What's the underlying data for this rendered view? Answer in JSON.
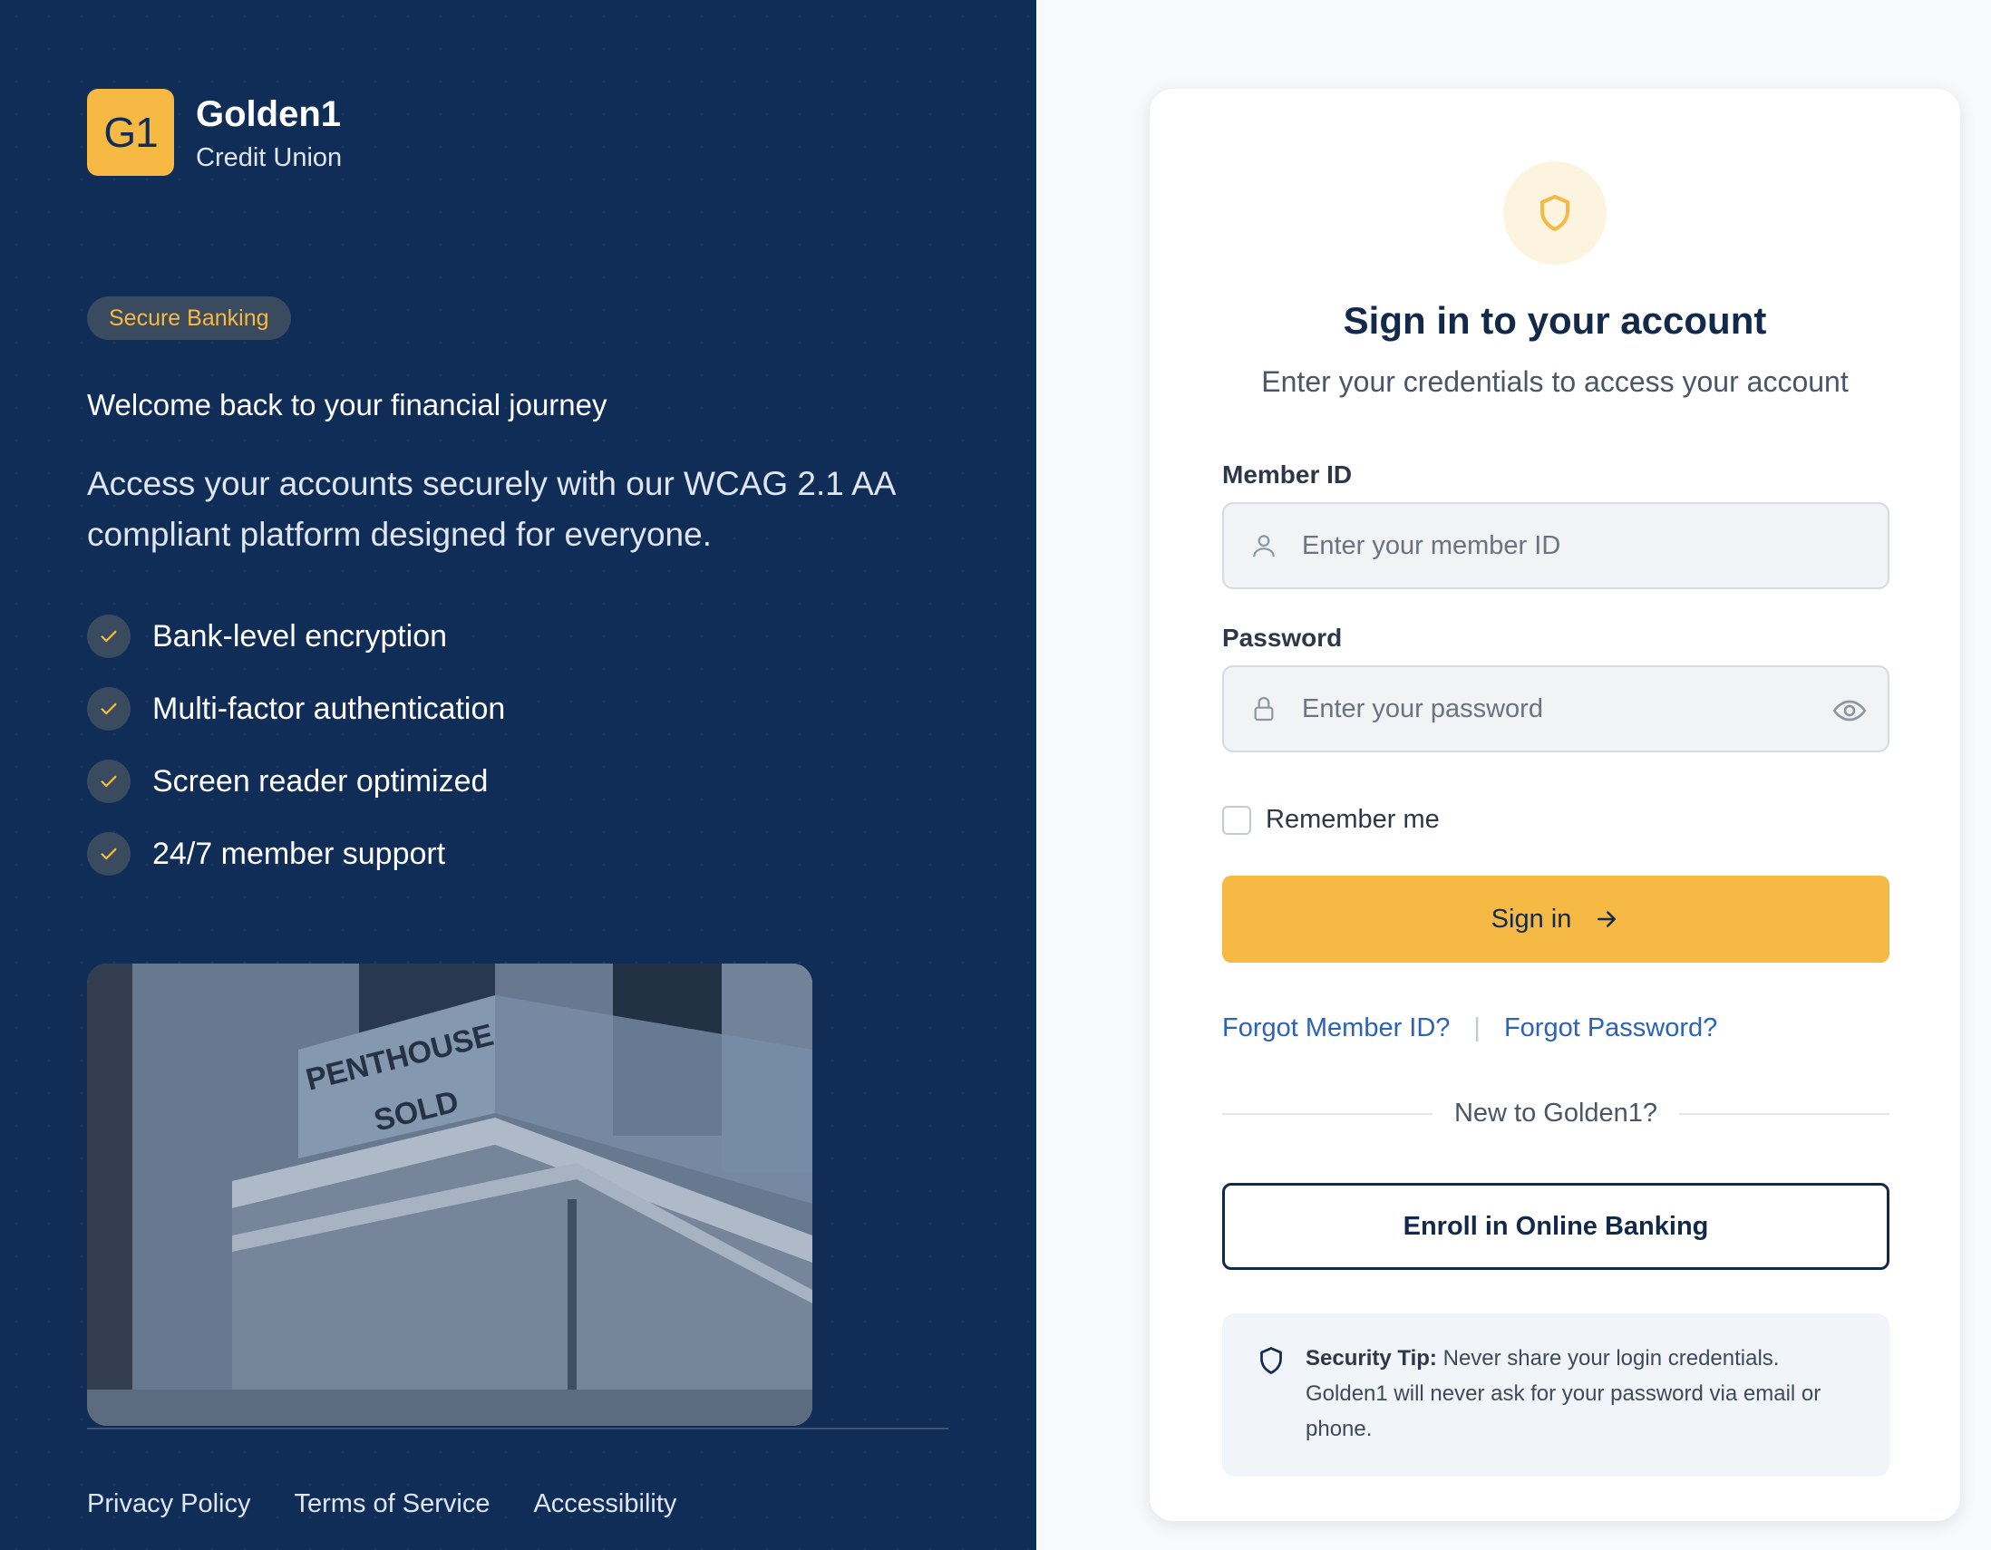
{
  "brand": {
    "logo_text": "G1",
    "name": "Golden1",
    "subtitle": "Credit Union"
  },
  "hero": {
    "badge": "Secure Banking",
    "welcome": "Welcome back to your financial journey",
    "description": "Access your accounts securely with our WCAG 2.1 AA compliant platform designed for everyone.",
    "features": [
      {
        "label": "Bank-level encryption"
      },
      {
        "label": "Multi-factor authentication"
      },
      {
        "label": "Screen reader optimized"
      },
      {
        "label": "24/7 member support"
      }
    ],
    "photo_sign": [
      "PENTHOUSE",
      "SOLD"
    ]
  },
  "footer": {
    "links": [
      "Privacy Policy",
      "Terms of Service",
      "Accessibility"
    ]
  },
  "login": {
    "title": "Sign in to your account",
    "subtitle": "Enter your credentials to access your account",
    "member_id": {
      "label": "Member ID",
      "placeholder": "Enter your member ID",
      "value": ""
    },
    "password": {
      "label": "Password",
      "placeholder": "Enter your password",
      "value": ""
    },
    "remember_label": "Remember me",
    "remember_checked": false,
    "signin_label": "Sign in",
    "forgot_member": "Forgot Member ID?",
    "forgot_separator": "|",
    "forgot_password": "Forgot Password?",
    "new_prompt": "New to Golden1?",
    "enroll_label": "Enroll in Online Banking",
    "tip_heading": "Security Tip:",
    "tip_body": " Never share your login credentials. Golden1 will never ask for your password via email or phone."
  },
  "icons": [
    "shield-icon",
    "user-icon",
    "lock-icon",
    "eye-icon",
    "arrow-right-icon",
    "check-icon"
  ],
  "colors": {
    "navy": "#0f2d57",
    "gold": "#f5b944",
    "link": "#2c62b8",
    "card": "#ffffff"
  }
}
